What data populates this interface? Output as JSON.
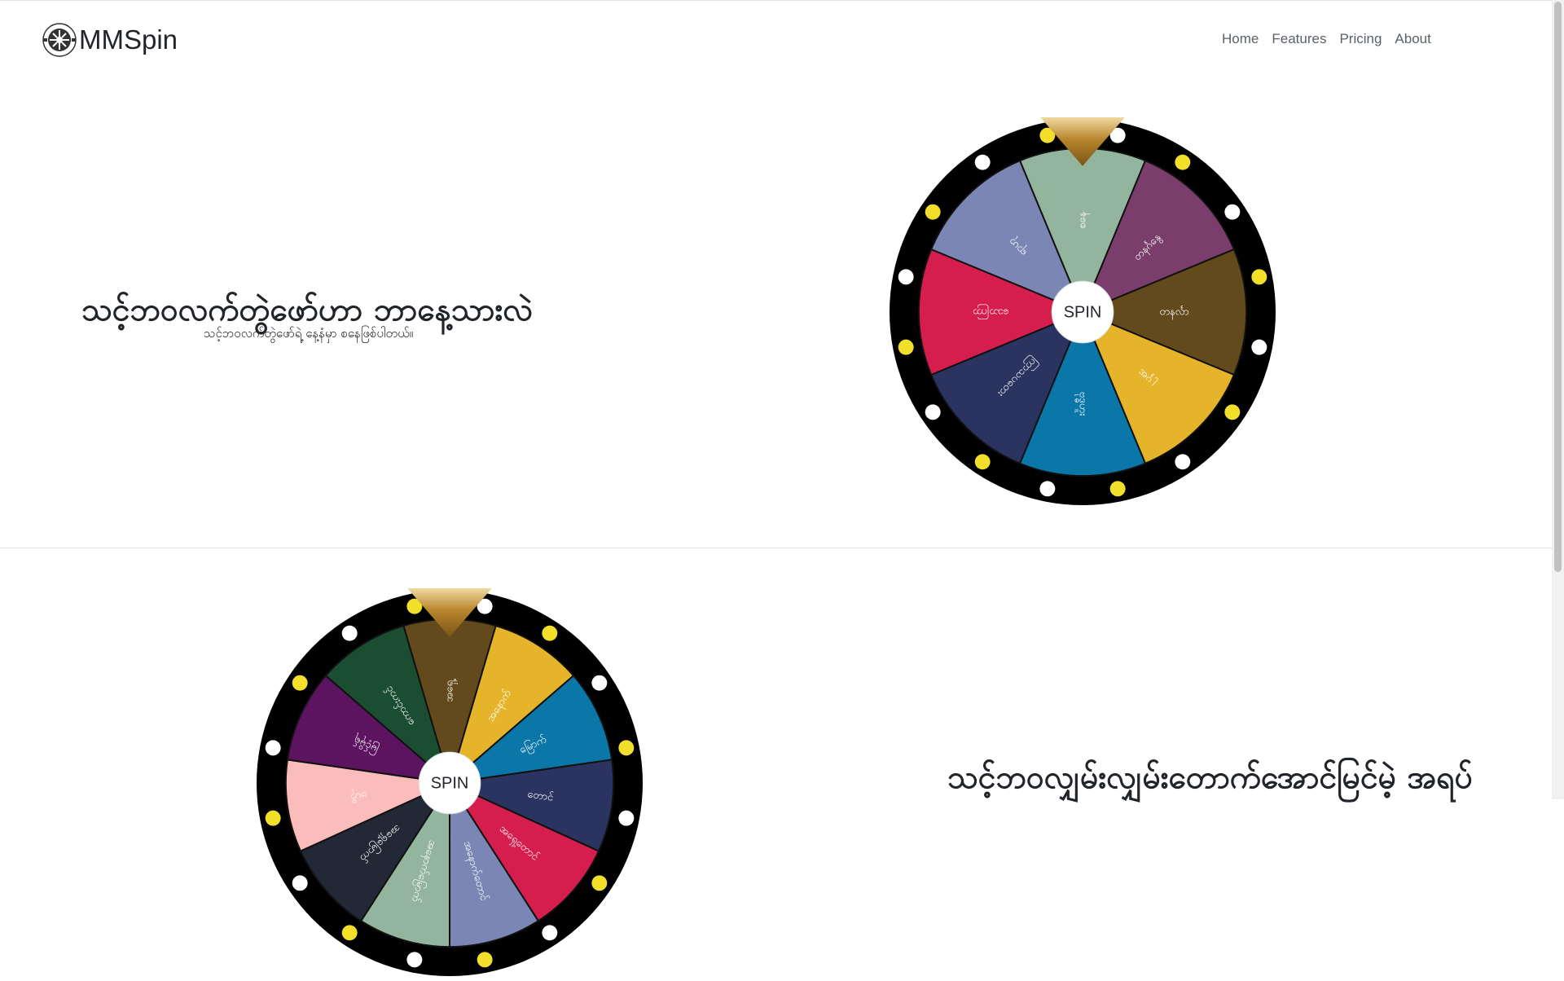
{
  "brand": {
    "name": "MMSpin",
    "logo_icon": "spin-wheel-logo-icon"
  },
  "nav": {
    "items": [
      "Home",
      "Features",
      "Pricing",
      "About"
    ]
  },
  "hero": {
    "title": "သင့်ဘဝလက်တွဲဖော်ဟာ ဘာနေ့သားလဲ",
    "subtitle": "သင့်ဘဝလက်တွဲဖော်ရဲ့ နေ့နံမှာ စနေဖြစ်ပါတယ်။"
  },
  "wheel1": {
    "center_label": "SPIN",
    "segments": [
      {
        "label": "စနေ",
        "color": "#93b59d"
      },
      {
        "label": "တနင်္ဂနွေ",
        "color": "#7b3d6b"
      },
      {
        "label": "တနင်္လာ",
        "color": "#624a1c"
      },
      {
        "label": "အင်္ဂါ",
        "color": "#e5b42a"
      },
      {
        "label": "ဗုဒ္ဓဟူး",
        "color": "#0b76a8"
      },
      {
        "label": "ကြာသပတေး",
        "color": "#2b3461"
      },
      {
        "label": "သောကြာ",
        "color": "#d51d4e"
      },
      {
        "label": "ရာဟု",
        "color": "#7b86b5"
      }
    ]
  },
  "section2": {
    "title": "သင့်ဘဝလျှမ်းလျှမ်းတောက်အောင်မြင်မဲ့ အရပ်"
  },
  "wheel2": {
    "center_label": "SPIN",
    "segments": [
      {
        "label": "အရှေ့",
        "color": "#624a1c"
      },
      {
        "label": "အနောက်",
        "color": "#e5b42a"
      },
      {
        "label": "မြောက်",
        "color": "#0b76a8"
      },
      {
        "label": "တောင်",
        "color": "#2b3461"
      },
      {
        "label": "အရှေ့တောင်",
        "color": "#d51d4e"
      },
      {
        "label": "အနောက်တောင်",
        "color": "#7b86b5"
      },
      {
        "label": "အနောက်မြောက်",
        "color": "#93b59d"
      },
      {
        "label": "အရှေ့မြောက်",
        "color": "#222836"
      },
      {
        "label": "ဗဟို",
        "color": "#fbbcbc"
      },
      {
        "label": "မြင့်မိုရ်",
        "color": "#5c1460"
      },
      {
        "label": "ကောင်းကင်",
        "color": "#1b4d33"
      }
    ]
  },
  "colors": {
    "rim": "#000000",
    "bulb_yellow": "#f2df2a",
    "bulb_white": "#ffffff",
    "pointer_gold": "#b8862d"
  }
}
